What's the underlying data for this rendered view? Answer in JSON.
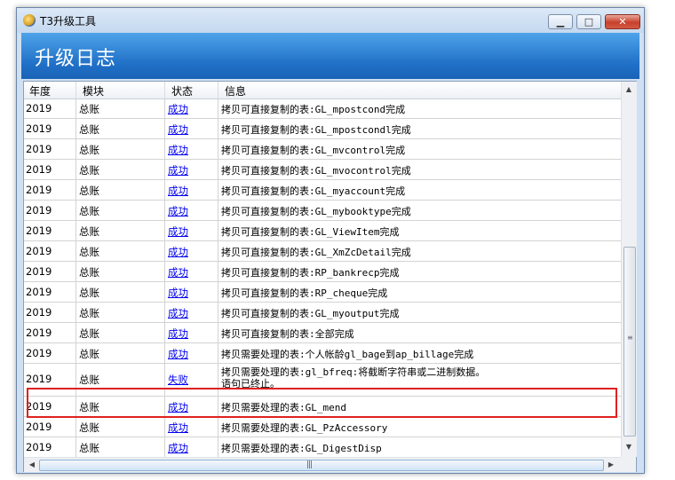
{
  "window": {
    "title": "T3升级工具",
    "minimize_label": "▁",
    "maximize_label": "□",
    "close_label": "✕"
  },
  "banner": {
    "title": "升级日志"
  },
  "grid": {
    "columns": [
      "年度",
      "模块",
      "状态",
      "信息"
    ],
    "rows": [
      {
        "year": "2019",
        "module": "总账",
        "status": "成功",
        "info": "拷贝可直接复制的表:GL_mpostcond完成"
      },
      {
        "year": "2019",
        "module": "总账",
        "status": "成功",
        "info": "拷贝可直接复制的表:GL_mpostcondl完成"
      },
      {
        "year": "2019",
        "module": "总账",
        "status": "成功",
        "info": "拷贝可直接复制的表:GL_mvcontrol完成"
      },
      {
        "year": "2019",
        "module": "总账",
        "status": "成功",
        "info": "拷贝可直接复制的表:GL_mvocontrol完成"
      },
      {
        "year": "2019",
        "module": "总账",
        "status": "成功",
        "info": "拷贝可直接复制的表:GL_myaccount完成"
      },
      {
        "year": "2019",
        "module": "总账",
        "status": "成功",
        "info": "拷贝可直接复制的表:GL_mybooktype完成"
      },
      {
        "year": "2019",
        "module": "总账",
        "status": "成功",
        "info": "拷贝可直接复制的表:GL_ViewItem完成"
      },
      {
        "year": "2019",
        "module": "总账",
        "status": "成功",
        "info": "拷贝可直接复制的表:GL_XmZcDetail完成"
      },
      {
        "year": "2019",
        "module": "总账",
        "status": "成功",
        "info": "拷贝可直接复制的表:RP_bankrecp完成"
      },
      {
        "year": "2019",
        "module": "总账",
        "status": "成功",
        "info": "拷贝可直接复制的表:RP_cheque完成"
      },
      {
        "year": "2019",
        "module": "总账",
        "status": "成功",
        "info": "拷贝可直接复制的表:GL_myoutput完成"
      },
      {
        "year": "2019",
        "module": "总账",
        "status": "成功",
        "info": "拷贝可直接复制的表:全部完成"
      },
      {
        "year": "2019",
        "module": "总账",
        "status": "成功",
        "info": "拷贝需要处理的表:个人帐龄gl_bage到ap_billage完成"
      },
      {
        "year": "2019",
        "module": "总账",
        "status": "失败",
        "info": "拷贝需要处理的表:gl_bfreq:将截断字符串或二进制数据。",
        "info2": "语句已终止。"
      },
      {
        "year": "2019",
        "module": "总账",
        "status": "成功",
        "info": "拷贝需要处理的表:GL_mend"
      },
      {
        "year": "2019",
        "module": "总账",
        "status": "成功",
        "info": "拷贝需要处理的表:GL_PzAccessory"
      },
      {
        "year": "2019",
        "module": "总账",
        "status": "成功",
        "info": "拷贝需要处理的表:GL_DigestDisp"
      }
    ]
  },
  "icons": {
    "app": "t3-app-icon",
    "scroll_up": "▲",
    "scroll_down": "▼",
    "scroll_left": "◀",
    "scroll_right": "▶",
    "grip_h": "|||",
    "grip_v": "≡"
  },
  "colors": {
    "link": "#0000ee",
    "highlight_border": "#e02020",
    "banner": "#1f6fc6"
  }
}
